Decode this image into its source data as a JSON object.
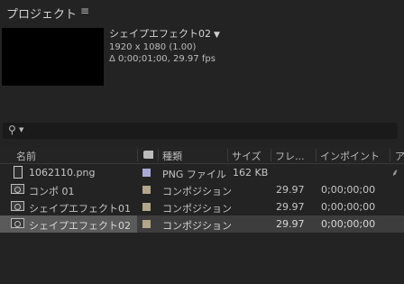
{
  "panel": {
    "title": "プロジェクト",
    "menu_icon": "hamburger-icon"
  },
  "preview": {
    "name": "シェイプエフェクト02",
    "caret": "▼",
    "resolution": "1920 x 1080 (1.00)",
    "duration": "Δ 0;00;01;00, 29.97 fps"
  },
  "search": {
    "icon": "search-icon",
    "chevron": "chevron-down-icon",
    "value": ""
  },
  "columns": {
    "name": "名前",
    "type": "種類",
    "size": "サイズ",
    "frame": "フレ...",
    "in_point": "インポイント",
    "extra": "ア"
  },
  "rows": [
    {
      "name": "1062110.png",
      "type": "PNG ファイル",
      "size": "162 KB",
      "fps": "",
      "in": "",
      "label_color": "#a9a9d6",
      "icon": "file-icon"
    },
    {
      "name": "コンポ 01",
      "type": "コンポジション",
      "size": "",
      "fps": "29.97",
      "in": "0;00;00;00",
      "label_color": "#b3a68a",
      "icon": "composition-icon"
    },
    {
      "name": "シェイプエフェクト01",
      "type": "コンポジション",
      "size": "",
      "fps": "29.97",
      "in": "0;00;00;00",
      "label_color": "#b3a68a",
      "icon": "composition-icon"
    },
    {
      "name": "シェイプエフェクト02",
      "type": "コンポジション",
      "size": "",
      "fps": "29.97",
      "in": "0;00;00;00",
      "label_color": "#b3a68a",
      "icon": "composition-icon"
    }
  ]
}
